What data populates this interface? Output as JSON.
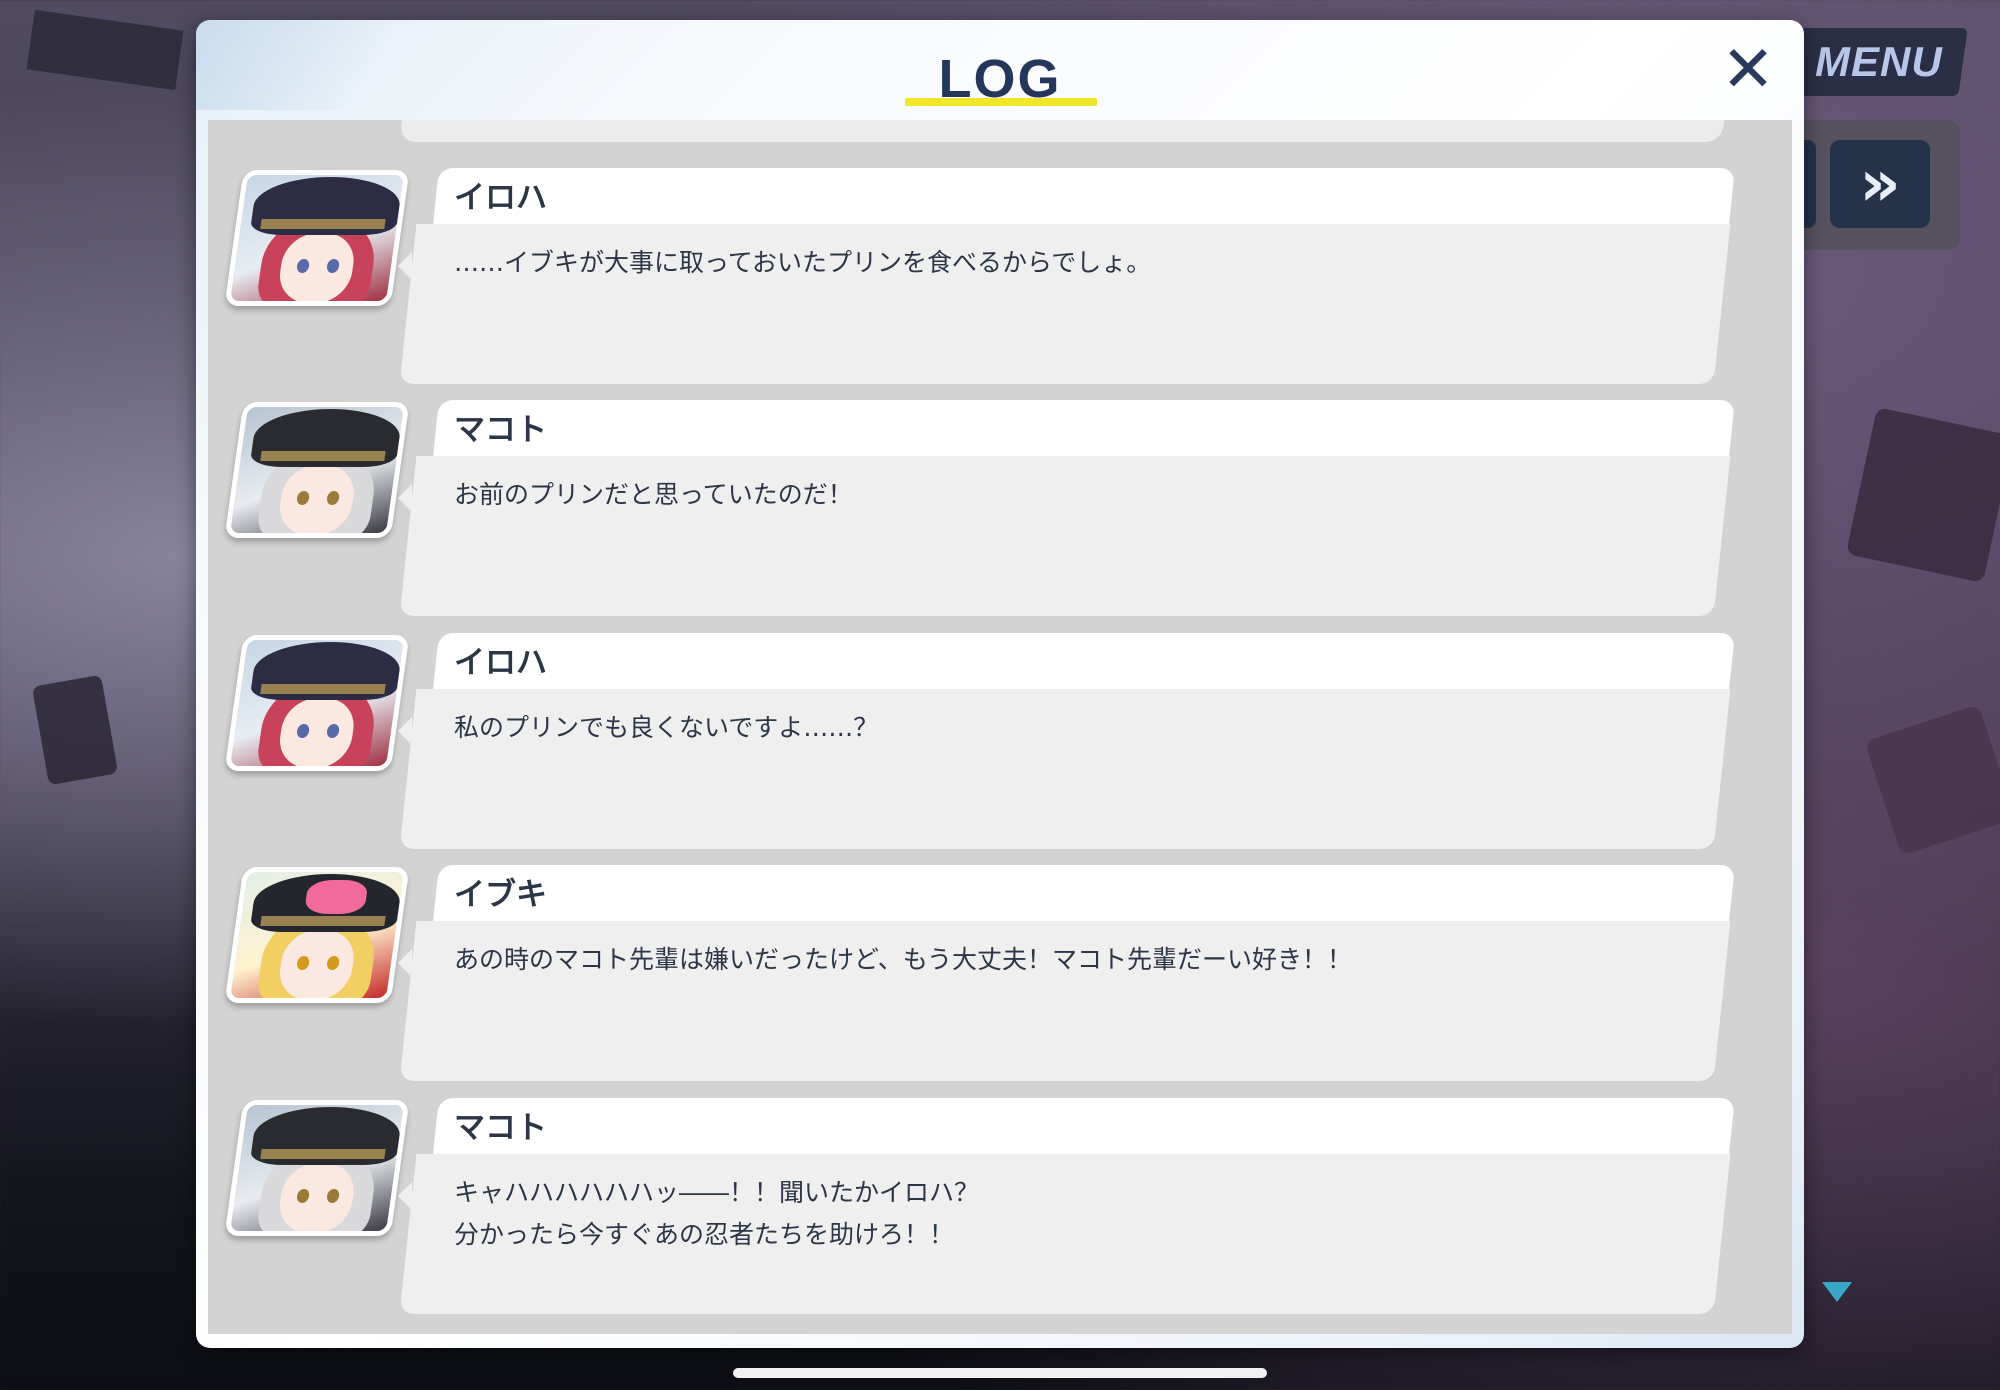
{
  "hud": {
    "menu_label": "MENU",
    "skip_glyph": "»"
  },
  "dialog": {
    "title": "LOG",
    "close_glyph": "✕"
  },
  "entries": [
    {
      "speaker": "イロハ",
      "text": "……イブキが大事に取っておいたプリンを食べるからでしょ。",
      "avatar": "iroha"
    },
    {
      "speaker": "マコト",
      "text": "お前のプリンだと思っていたのだ！",
      "avatar": "makoto"
    },
    {
      "speaker": "イロハ",
      "text": "私のプリンでも良くないですよ……？",
      "avatar": "iroha"
    },
    {
      "speaker": "イブキ",
      "text": "あの時のマコト先輩は嫌いだったけど、もう大丈夫！マコト先輩だーい好き！！",
      "avatar": "ibuki"
    },
    {
      "speaker": "マコト",
      "text": "キャハハハハハハッ――！！聞いたかイロハ？\n分かったら今すぐあの忍者たちを助けろ！！",
      "avatar": "makoto"
    }
  ],
  "colors": {
    "title_underline": "#f2e52c",
    "title_text": "#24365a",
    "scroll_indicator": "#3aa6c8"
  }
}
